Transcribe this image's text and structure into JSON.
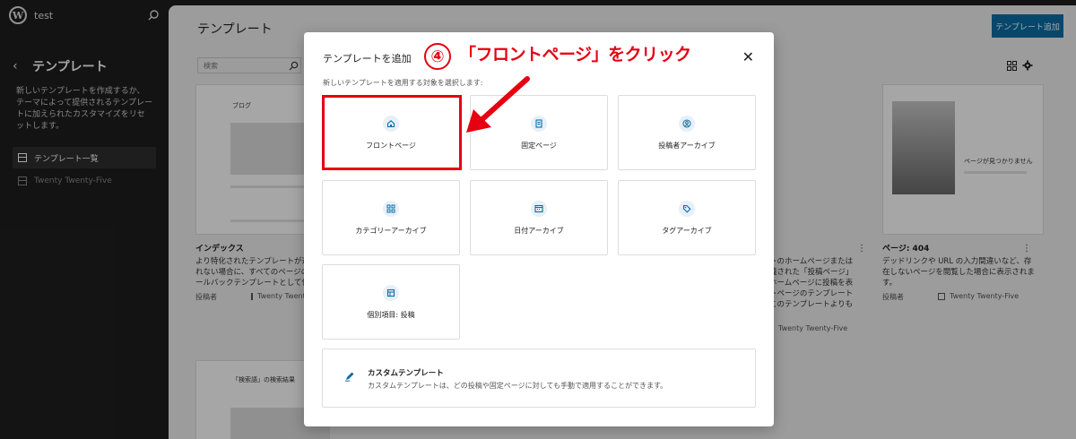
{
  "site": {
    "name": "test"
  },
  "sidebar": {
    "title": "テンプレート",
    "description": "新しいテンプレートを作成するか、テーマによって提供されるテンプレートに加えられたカスタマイズをリセットします。",
    "items": [
      {
        "label": "テンプレート一覧"
      },
      {
        "label": "Twenty Twenty-Five"
      }
    ]
  },
  "main": {
    "title": "テンプレート",
    "add_button": "テンプレート追加",
    "search_placeholder": "検索",
    "cards": [
      {
        "preview_label": "ブログ",
        "title": "インデックス",
        "description": "より特化されたテンプレートが適用されない場合に、すべてのページのフォールバックテンプレートとして使用します。",
        "author_label": "投稿者",
        "theme": "Twenty Twenty-Five"
      },
      {
        "title": "",
        "description": "トのホームページまたは義された「投稿ページ」ホームページに投稿を表トページのテンプレートこのテンプレートよりも",
        "theme": "Twenty Twenty-Five"
      },
      {
        "preview_label": "ページが見つかりません",
        "title": "ページ: 404",
        "description": "デッドリンクや URL の入力間違いなど、存在しないページを閲覧した場合に表示されます。",
        "author_label": "投稿者",
        "theme": "Twenty Twenty-Five"
      },
      {
        "preview_label": "「検索語」の検索結果"
      }
    ]
  },
  "modal": {
    "title": "テンプレートを追加",
    "subtitle": "新しいテンプレートを適用する対象を選択します:",
    "options": [
      {
        "label": "フロントページ",
        "icon": "home-icon"
      },
      {
        "label": "固定ページ",
        "icon": "page-icon"
      },
      {
        "label": "投稿者アーカイブ",
        "icon": "user-icon"
      },
      {
        "label": "カテゴリーアーカイブ",
        "icon": "category-icon"
      },
      {
        "label": "日付アーカイブ",
        "icon": "calendar-icon"
      },
      {
        "label": "タグアーカイブ",
        "icon": "tag-icon"
      },
      {
        "label": "個別項目: 投稿",
        "icon": "post-icon"
      }
    ],
    "custom": {
      "title": "カスタムテンプレート",
      "description": "カスタムテンプレートは、どの投稿や固定ページに対しても手動で適用することができます。"
    }
  },
  "annotation": {
    "number": "④",
    "text": "「フロントページ」をクリック",
    "color": "#e60012"
  },
  "colors": {
    "accent": "#0c6ea6",
    "sidebar_bg": "#1e1e1e"
  }
}
